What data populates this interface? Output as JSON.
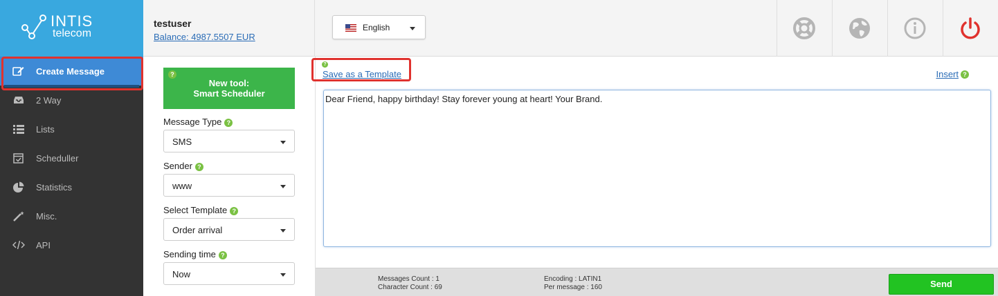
{
  "brand": {
    "line1": "INTIS",
    "line2": "telecom"
  },
  "user": {
    "name": "testuser",
    "balance": "Balance: 4987.5507 EUR"
  },
  "language": {
    "selected": "English"
  },
  "sidebar": {
    "items": [
      {
        "label": "Create Message",
        "icon": "edit-icon"
      },
      {
        "label": "2 Way",
        "icon": "inbox-icon"
      },
      {
        "label": "Lists",
        "icon": "list-icon"
      },
      {
        "label": "Scheduller",
        "icon": "calendar-icon"
      },
      {
        "label": "Statistics",
        "icon": "pie-chart-icon"
      },
      {
        "label": "Misc.",
        "icon": "magic-wand-icon"
      },
      {
        "label": "API",
        "icon": "code-icon"
      }
    ]
  },
  "form": {
    "promo_line1": "New tool:",
    "promo_line2": "Smart Scheduler",
    "message_type": {
      "label": "Message Type",
      "value": "SMS"
    },
    "sender": {
      "label": "Sender",
      "value": "www"
    },
    "template": {
      "label": "Select Template",
      "value": "Order arrival"
    },
    "sending_time": {
      "label": "Sending time",
      "value": "Now"
    }
  },
  "editor": {
    "save_template": "Save as a Template",
    "insert": "Insert",
    "message": "Dear Friend, happy birthday! Stay forever young at heart! Your Brand."
  },
  "stats": {
    "messages_count": "Messages Count : 1",
    "character_count": "Character Count : 69",
    "encoding": "Encoding : LATIN1",
    "per_message": "Per message : 160"
  },
  "send_label": "Send",
  "help_glyph": "?",
  "colors": {
    "header_blue": "#39a8df",
    "active_nav": "#3e8ad6",
    "promo_green": "#3cb54a",
    "send_green": "#22c322",
    "power_red": "#e0322e",
    "highlight_red": "#e0322e"
  }
}
